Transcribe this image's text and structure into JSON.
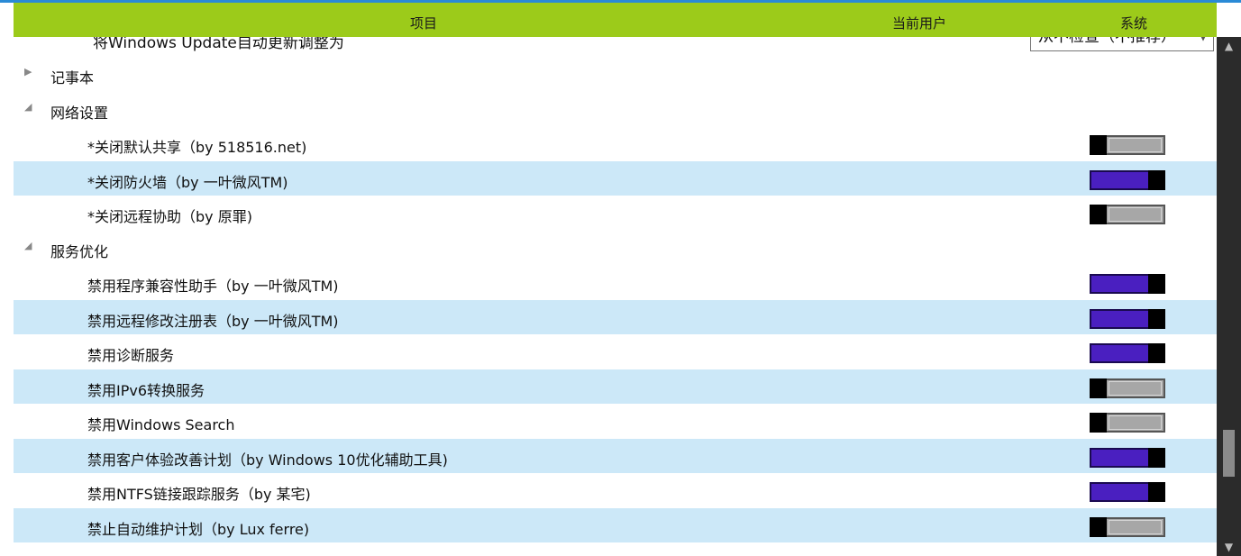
{
  "header": {
    "col_item": "项目",
    "col_user": "当前用户",
    "col_system": "系统"
  },
  "partial_row": {
    "label": "将Windows Update自动更新调整为",
    "select_value": "从不检查（不推荐）"
  },
  "rows": [
    {
      "type": "group",
      "label": "记事本",
      "expanded": false
    },
    {
      "type": "group",
      "label": "网络设置",
      "expanded": true
    },
    {
      "type": "item",
      "label": "*关闭默认共享（by 518516.net)",
      "state": "off"
    },
    {
      "type": "item",
      "label": "*关闭防火墙（by 一叶微风TM)",
      "state": "on",
      "highlighted": true
    },
    {
      "type": "item",
      "label": "*关闭远程协助（by 原罪)",
      "state": "off"
    },
    {
      "type": "group",
      "label": "服务优化",
      "expanded": true
    },
    {
      "type": "item",
      "label": "禁用程序兼容性助手（by 一叶微风TM)",
      "state": "on"
    },
    {
      "type": "item",
      "label": "禁用远程修改注册表（by 一叶微风TM)",
      "state": "on",
      "highlighted": true
    },
    {
      "type": "item",
      "label": "禁用诊断服务",
      "state": "on"
    },
    {
      "type": "item",
      "label": "禁用IPv6转换服务",
      "state": "off",
      "highlighted": true
    },
    {
      "type": "item",
      "label": "禁用Windows Search",
      "state": "off"
    },
    {
      "type": "item",
      "label": "禁用客户体验改善计划（by Windows 10优化辅助工具)",
      "state": "on",
      "highlighted": true
    },
    {
      "type": "item",
      "label": "禁用NTFS链接跟踪服务（by 某宅)",
      "state": "on"
    },
    {
      "type": "item",
      "label": "禁止自动维护计划（by Lux ferre)",
      "state": "off",
      "highlighted": true
    }
  ],
  "icons": {
    "collapsed": "triangle-right-icon",
    "expanded": "triangle-down-icon"
  },
  "colors": {
    "header_bg": "#9ccb1a",
    "highlight_row": "#cce8f8",
    "toggle_on": "#4a1fc0",
    "toggle_off": "#a7a7a7"
  }
}
